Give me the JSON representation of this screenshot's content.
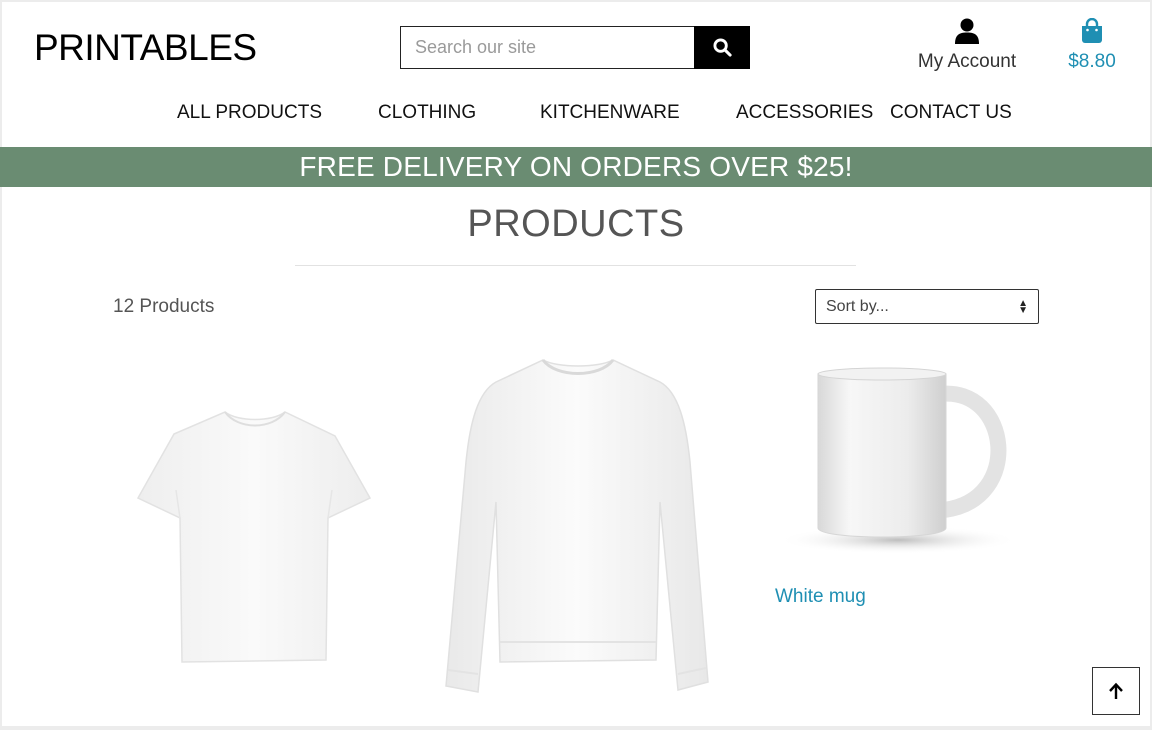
{
  "header": {
    "logo": "PRINTABLES",
    "search": {
      "placeholder": "Search our site",
      "value": "",
      "button_icon": "search-icon"
    },
    "account": {
      "label": "My Account",
      "icon": "user-icon"
    },
    "cart": {
      "total": "$8.80",
      "icon": "shopping-bag-icon",
      "color": "#1f8fb3"
    }
  },
  "nav": {
    "items": [
      {
        "label": "ALL PRODUCTS"
      },
      {
        "label": "CLOTHING"
      },
      {
        "label": "KITCHENWARE"
      },
      {
        "label": "ACCESSORIES"
      },
      {
        "label": "CONTACT US"
      }
    ]
  },
  "banner": {
    "text": "FREE DELIVERY ON ORDERS OVER $25!",
    "color": "#6a8c72"
  },
  "main": {
    "title": "PRODUCTS",
    "count": "12 Products",
    "sort": {
      "selected": "Sort by...",
      "icon": "sort-arrows-icon"
    },
    "products": [
      {
        "image": "white t-shirt",
        "name": ""
      },
      {
        "image": "white sweatshirt",
        "name": ""
      },
      {
        "image": "white mug",
        "name": "White mug"
      }
    ]
  },
  "back_to_top": {
    "icon": "arrow-up-icon"
  }
}
